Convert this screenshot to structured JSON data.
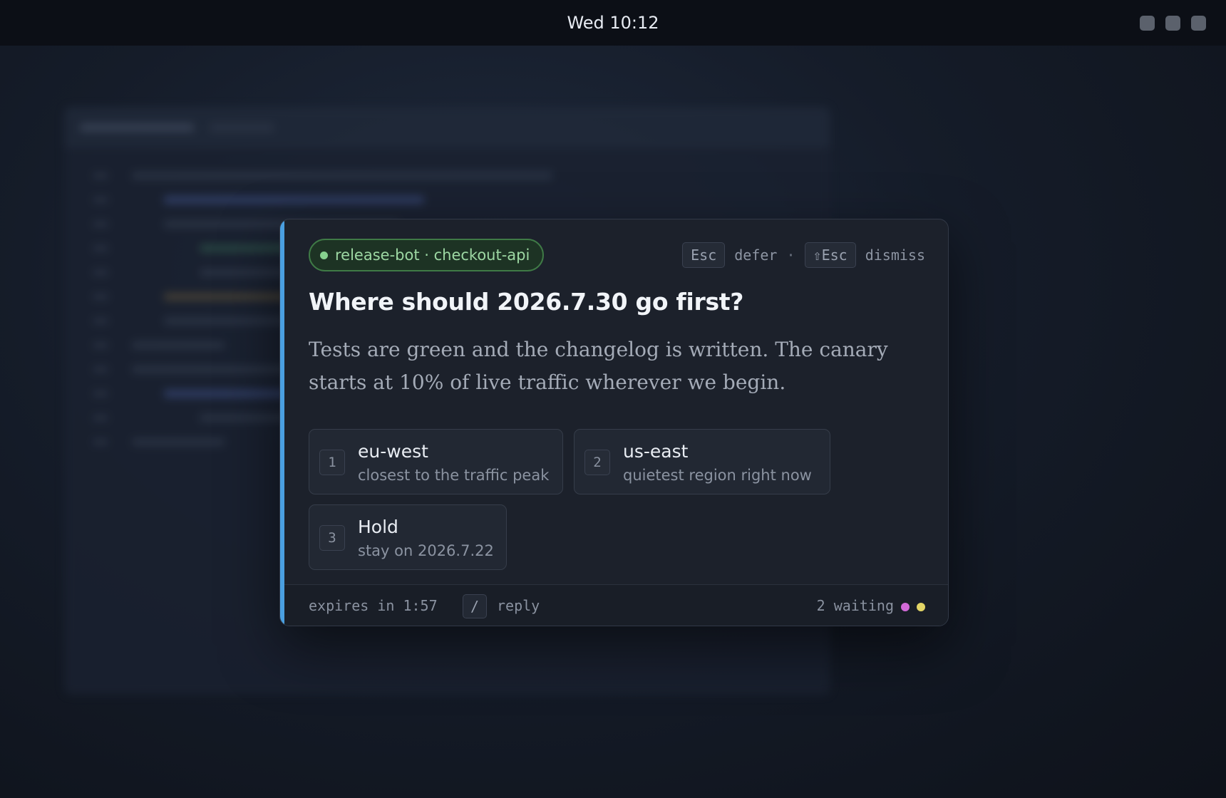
{
  "topbar": {
    "clock": "Wed 10:12",
    "tray_icons": [
      "tray-icon-1",
      "tray-icon-2",
      "tray-icon-3"
    ]
  },
  "dialog": {
    "source": "release-bot · checkout-api",
    "shortcuts": {
      "defer_key": "Esc",
      "defer_label": "defer",
      "separator": "·",
      "dismiss_key": "⇧Esc",
      "dismiss_label": "dismiss"
    },
    "title": "Where should 2026.7.30 go first?",
    "body": "Tests are green and the changelog is written. The canary starts at 10% of live traffic wherever we begin.",
    "options": [
      {
        "key": "1",
        "label": "eu-west",
        "sub": "closest to the traffic peak"
      },
      {
        "key": "2",
        "label": "us-east",
        "sub": "quietest region right now"
      },
      {
        "key": "3",
        "label": "Hold",
        "sub": "stay on 2026.7.22"
      }
    ],
    "footer": {
      "expires": "expires in 1:57",
      "reply_key": "/",
      "reply_label": "reply",
      "waiting": "2 waiting"
    }
  },
  "colors": {
    "accent": "#4a9fe0",
    "source_green": "#86d08e",
    "waiting_dot_1": "#d26ad8",
    "waiting_dot_2": "#e3d566"
  }
}
